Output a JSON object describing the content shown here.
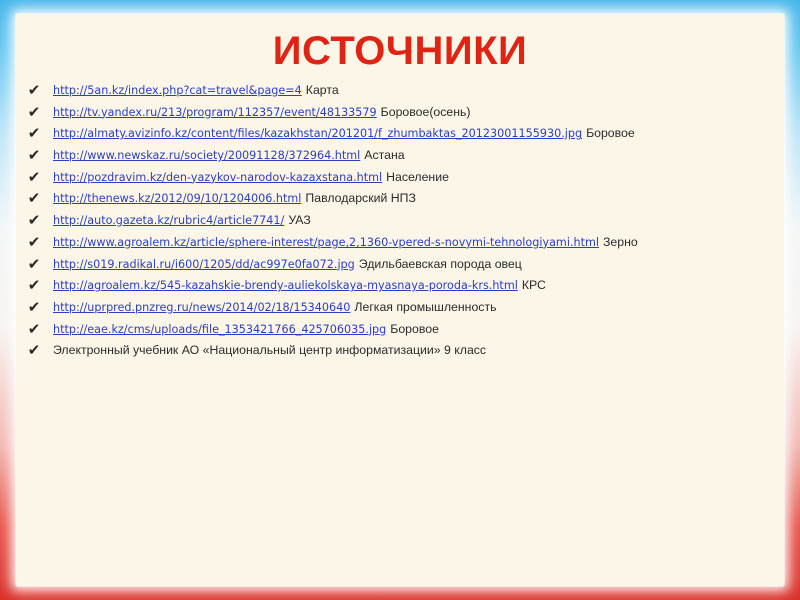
{
  "title": "ИСТОЧНИКИ",
  "colors": {
    "title": "#e02414",
    "link": "#2a3fc4",
    "text": "#2b2b2b"
  },
  "check_icon": "checkmark-icon",
  "sources": [
    {
      "url": "http://5an.kz/index.php?cat=travel&page=4",
      "desc": "Карта"
    },
    {
      "url": "http://tv.yandex.ru/213/program/112357/event/48133579",
      "desc": "Боровое(осень)"
    },
    {
      "url": "http://almaty.avizinfo.kz/content/files/kazakhstan/201201/f_zhumbaktas_20123001155930.jpg",
      "desc": "Боровое"
    },
    {
      "url": "http://www.newskaz.ru/society/20091128/372964.html",
      "desc": "Астана"
    },
    {
      "url": "http://pozdravim.kz/den-yazykov-narodov-kazaxstana.html",
      "desc": "Население"
    },
    {
      "url": "http://thenews.kz/2012/09/10/1204006.html",
      "desc": "Павлодарский НПЗ"
    },
    {
      "url": "http://auto.gazeta.kz/rubric4/article7741/",
      "desc": "УАЗ"
    },
    {
      "url": "http://www.agroalem.kz/article/sphere-interest/page,2,1360-vpered-s-novymi-tehnologiyami.html",
      "desc": "Зерно"
    },
    {
      "url": "http://s019.radikal.ru/i600/1205/dd/ac997e0fa072.jpg",
      "desc": "Эдильбаевская порода овец"
    },
    {
      "url": "http://agroalem.kz/545-kazahskie-brendy-auliekolskaya-myasnaya-poroda-krs.html",
      "desc": "КРС"
    },
    {
      "url": "http://uprpred.pnzreg.ru/news/2014/02/18/15340640",
      "desc": "Легкая промышленность"
    },
    {
      "url": "http://eae.kz/cms/uploads/file_1353421766_425706035.jpg",
      "desc": "Боровое"
    }
  ],
  "footer_source": "Электронный учебник АО «Национальный  центр информатизации» 9 класс"
}
